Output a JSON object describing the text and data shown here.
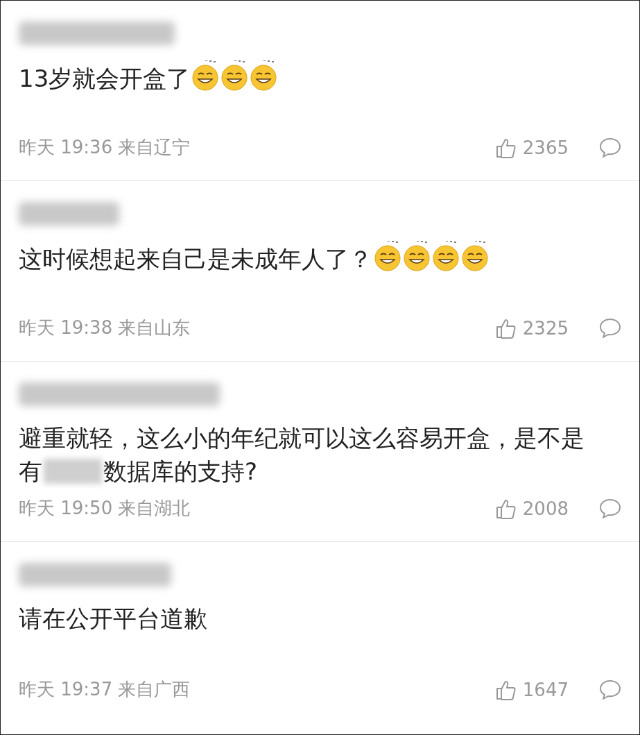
{
  "comments": [
    {
      "content": [
        {
          "kind": "text",
          "text": "13岁就会开盒了"
        },
        {
          "kind": "emoji"
        },
        {
          "kind": "emoji"
        },
        {
          "kind": "emoji"
        }
      ],
      "meta": "昨天 19:36 来自辽宁",
      "likes": "2365"
    },
    {
      "content": [
        {
          "kind": "text",
          "text": "这时候想起来自己是未成年人了？"
        },
        {
          "kind": "emoji"
        },
        {
          "kind": "emoji"
        },
        {
          "kind": "emoji"
        },
        {
          "kind": "emoji"
        }
      ],
      "meta": "昨天 19:38 来自山东",
      "likes": "2325"
    },
    {
      "content": [
        {
          "kind": "text",
          "text": "避重就轻，这么小的年纪就可以这么容易开盒，是不是有"
        },
        {
          "kind": "redacted"
        },
        {
          "kind": "text",
          "text": "数据库的支持?"
        }
      ],
      "meta": "昨天 19:50 来自湖北",
      "likes": "2008"
    },
    {
      "content": [
        {
          "kind": "text",
          "text": "请在公开平台道歉"
        }
      ],
      "meta": "昨天 19:37 来自广西",
      "likes": "1647"
    }
  ]
}
